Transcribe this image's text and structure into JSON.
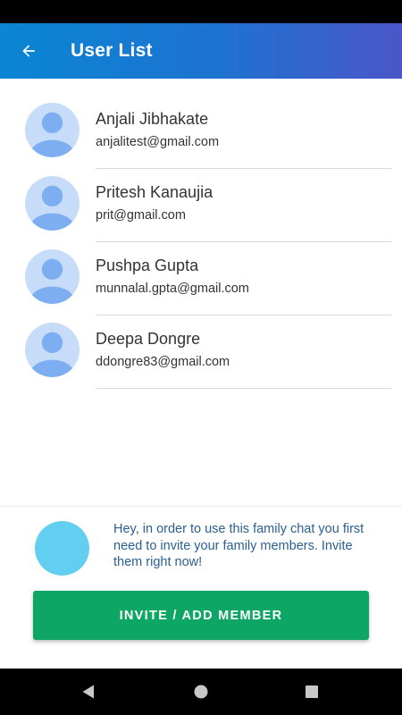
{
  "app_bar": {
    "title": "User List",
    "gradient": [
      "#0a86d3",
      "#4b56c8"
    ]
  },
  "users": [
    {
      "name": "Anjali Jibhakate",
      "email": "anjalitest@gmail.com"
    },
    {
      "name": "Pritesh Kanaujia",
      "email": "prit@gmail.com"
    },
    {
      "name": "Pushpa Gupta",
      "email": "munnalal.gpta@gmail.com"
    },
    {
      "name": "Deepa Dongre",
      "email": "ddongre83@gmail.com"
    }
  ],
  "invite": {
    "message": "Hey, in order to use this family chat you first need to invite your family members. Invite them right now!",
    "button_label": "INVITE / ADD MEMBER",
    "button_color": "#0ea664",
    "avatar_color": "#62cff0"
  },
  "icons": {
    "back": "arrow-left-icon",
    "avatar": "user-placeholder-icon",
    "nav_back": "triangle-back-icon",
    "nav_home": "circle-home-icon",
    "nav_recents": "square-recents-icon"
  }
}
